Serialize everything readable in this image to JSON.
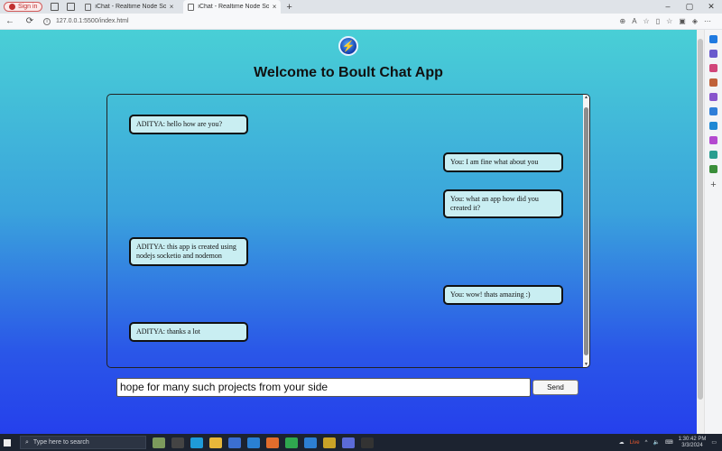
{
  "browser": {
    "signin_label": "Sign in",
    "tabs": [
      {
        "label": "iChat - Realtime Node Socket.io",
        "close": "×"
      },
      {
        "label": "iChat - Realtime Node Socket.io",
        "close": "×"
      }
    ],
    "new_tab": "+",
    "window_controls": {
      "minimize": "–",
      "maximize": "▢",
      "close": "✕"
    },
    "url": "127.0.0.1:5500/index.html",
    "nav": {
      "back": "←",
      "refresh": "⟳"
    }
  },
  "app": {
    "logo_glyph": "⚡",
    "title": "Welcome to Boult Chat App",
    "messages": [
      {
        "side": "left",
        "text": "ADITYA: hello how are you?"
      },
      {
        "side": "right",
        "text": "You: I am fine what about you"
      },
      {
        "side": "right",
        "text": "You: what an app how did you created it?"
      },
      {
        "side": "left",
        "text": "ADITYA: this app is created using nodejs socketio and nodemon"
      },
      {
        "side": "right",
        "text": "You: wow! thats amazing :)"
      },
      {
        "side": "left",
        "text": "ADITYA: thanks a lot"
      }
    ],
    "input_value": "hope for many such projects from your side",
    "send_label": "Send"
  },
  "taskbar": {
    "search_placeholder": "Type here to search",
    "tray_live": "Live",
    "time": "1:30:42 PM",
    "date": "3/3/2024"
  },
  "colors": {
    "bubble_bg": "#c9eef2",
    "page_gradient_top": "#49cfd6",
    "page_gradient_bottom": "#2540ec"
  }
}
